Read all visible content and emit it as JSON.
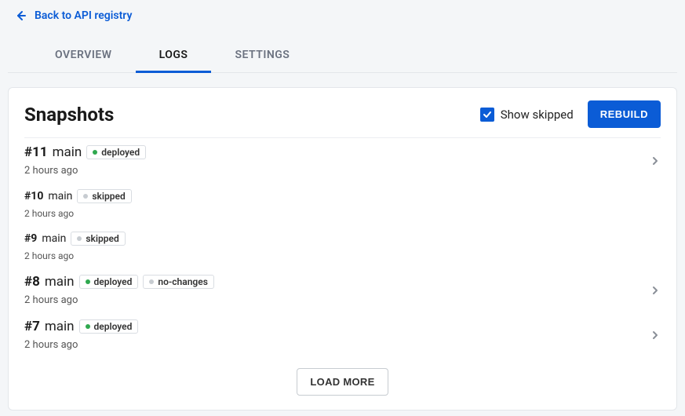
{
  "back_link": {
    "label": "Back to API registry"
  },
  "tabs": [
    {
      "label": "OVERVIEW",
      "active": false
    },
    {
      "label": "LOGS",
      "active": true
    },
    {
      "label": "SETTINGS",
      "active": false
    }
  ],
  "card": {
    "title": "Snapshots",
    "show_skipped_label": "Show skipped",
    "show_skipped_checked": true,
    "rebuild_label": "REBUILD",
    "load_more_label": "LOAD MORE"
  },
  "snapshots": [
    {
      "id": "#11",
      "branch": "main",
      "time": "2 hours ago",
      "large": true,
      "clickable": true,
      "badges": [
        {
          "text": "deployed",
          "dot": "green"
        }
      ]
    },
    {
      "id": "#10",
      "branch": "main",
      "time": "2 hours ago",
      "large": false,
      "clickable": false,
      "badges": [
        {
          "text": "skipped",
          "dot": "gray"
        }
      ]
    },
    {
      "id": "#9",
      "branch": "main",
      "time": "2 hours ago",
      "large": false,
      "clickable": false,
      "badges": [
        {
          "text": "skipped",
          "dot": "gray"
        }
      ]
    },
    {
      "id": "#8",
      "branch": "main",
      "time": "2 hours ago",
      "large": true,
      "clickable": true,
      "badges": [
        {
          "text": "deployed",
          "dot": "green"
        },
        {
          "text": "no-changes",
          "dot": "gray"
        }
      ]
    },
    {
      "id": "#7",
      "branch": "main",
      "time": "2 hours ago",
      "large": true,
      "clickable": true,
      "badges": [
        {
          "text": "deployed",
          "dot": "green"
        }
      ]
    }
  ]
}
